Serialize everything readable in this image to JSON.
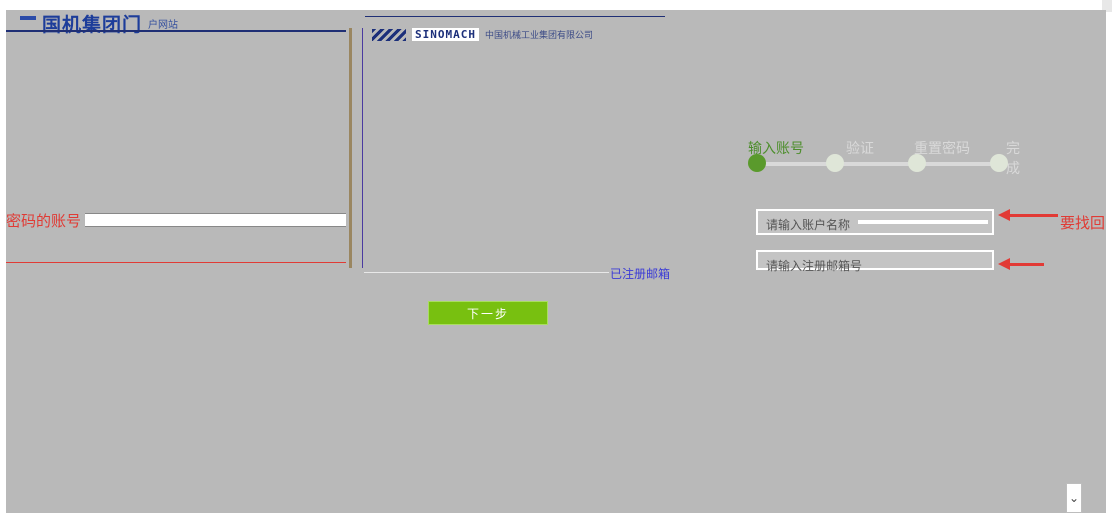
{
  "header": {
    "logo_text": "国机集团门",
    "logo_slogan": "户网站",
    "brand_en": "SINOMACH",
    "brand_tagline": "中国机械工业集团有限公司"
  },
  "steps": [
    {
      "label": "输入账号",
      "active": true
    },
    {
      "label": "验证",
      "active": false
    },
    {
      "label": "重置密码",
      "active": false
    },
    {
      "label": "完成",
      "active": false
    }
  ],
  "left_banner": {
    "text": "密码的账号"
  },
  "form": {
    "account_placeholder": "请输入账户名称",
    "email_placeholder": "请输入注册邮箱号"
  },
  "right_hint": {
    "text": "要找回"
  },
  "under_text": "已注册邮箱",
  "next_button": {
    "label": "下一步"
  },
  "dropdown_icon": "chevron-down-icon",
  "colors": {
    "accent_green": "#78c010",
    "step_green": "#5a9a2c",
    "annotation_red": "#e03b35",
    "brand_blue": "#1d3d9a"
  }
}
